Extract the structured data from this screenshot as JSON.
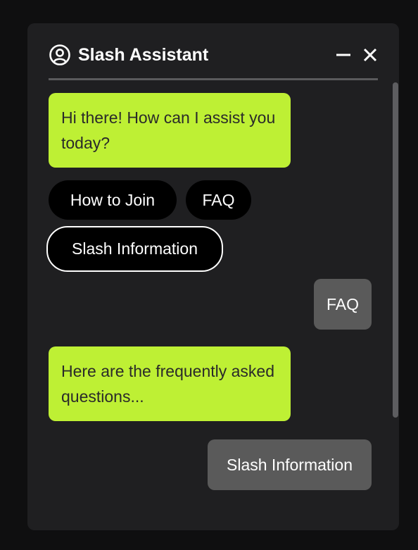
{
  "header": {
    "title": "Slash Assistant",
    "user_icon": "user-circle-icon",
    "minimize_icon": "minimize-icon",
    "close_icon": "close-icon"
  },
  "colors": {
    "background": "#0f0f10",
    "panel": "#1f1f21",
    "bot_bubble": "#bef034",
    "user_bubble": "#5a5a5a",
    "chip": "#000000",
    "chip_active_border": "#ffffff"
  },
  "messages": [
    {
      "from": "bot",
      "text": "Hi there! How can I assist you today?"
    },
    {
      "from": "user",
      "text": "FAQ"
    },
    {
      "from": "bot",
      "text": "Here are the frequently asked questions..."
    },
    {
      "from": "user",
      "text": "Slash Information"
    }
  ],
  "quick_replies": [
    {
      "label": "How to Join",
      "active": false
    },
    {
      "label": "FAQ",
      "active": false
    },
    {
      "label": "Slash Information",
      "active": true
    }
  ]
}
